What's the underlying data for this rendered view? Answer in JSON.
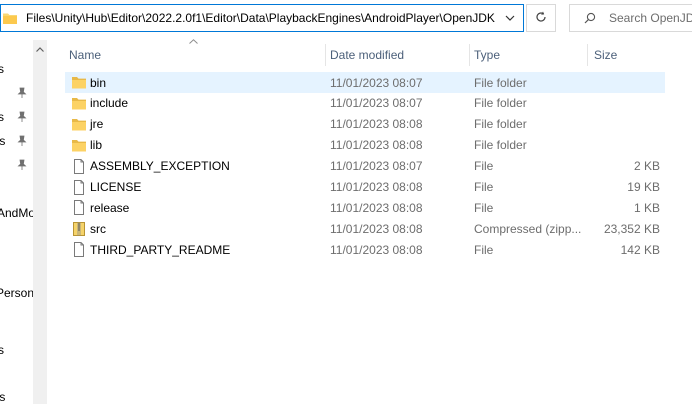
{
  "address_bar": {
    "path": "Files\\Unity\\Hub\\Editor\\2022.2.0f1\\Editor\\Data\\PlaybackEngines\\AndroidPlayer\\OpenJDK"
  },
  "search": {
    "placeholder": "Search OpenJDK"
  },
  "nav": {
    "items": [
      {
        "label": "s",
        "pinned": false
      },
      {
        "label": "",
        "pinned": true
      },
      {
        "label": "s",
        "pinned": true
      },
      {
        "label": "ts",
        "pinned": true
      },
      {
        "label": "",
        "pinned": true
      },
      {
        "label": "AndMo",
        "pinned": false
      },
      {
        "label": "Person",
        "pinned": false
      },
      {
        "label": "s",
        "pinned": false
      },
      {
        "label": "ts",
        "pinned": false
      }
    ]
  },
  "columns": {
    "name": "Name",
    "date": "Date modified",
    "type": "Type",
    "size": "Size"
  },
  "files": [
    {
      "name": "bin",
      "date": "11/01/2023 08:07",
      "type": "File folder",
      "size": "",
      "icon": "folder",
      "selected": true
    },
    {
      "name": "include",
      "date": "11/01/2023 08:07",
      "type": "File folder",
      "size": "",
      "icon": "folder",
      "selected": false
    },
    {
      "name": "jre",
      "date": "11/01/2023 08:08",
      "type": "File folder",
      "size": "",
      "icon": "folder",
      "selected": false
    },
    {
      "name": "lib",
      "date": "11/01/2023 08:08",
      "type": "File folder",
      "size": "",
      "icon": "folder",
      "selected": false
    },
    {
      "name": "ASSEMBLY_EXCEPTION",
      "date": "11/01/2023 08:07",
      "type": "File",
      "size": "2 KB",
      "icon": "file",
      "selected": false
    },
    {
      "name": "LICENSE",
      "date": "11/01/2023 08:08",
      "type": "File",
      "size": "19 KB",
      "icon": "file",
      "selected": false
    },
    {
      "name": "release",
      "date": "11/01/2023 08:08",
      "type": "File",
      "size": "1 KB",
      "icon": "file",
      "selected": false
    },
    {
      "name": "src",
      "date": "11/01/2023 08:08",
      "type": "Compressed (zipp...",
      "size": "23,352 KB",
      "icon": "zip",
      "selected": false
    },
    {
      "name": "THIRD_PARTY_README",
      "date": "11/01/2023 08:08",
      "type": "File",
      "size": "142 KB",
      "icon": "file",
      "selected": false
    }
  ],
  "colors": {
    "accent": "#0078d7",
    "folder": "#f8d775",
    "selected_row": "#e5f3ff"
  }
}
